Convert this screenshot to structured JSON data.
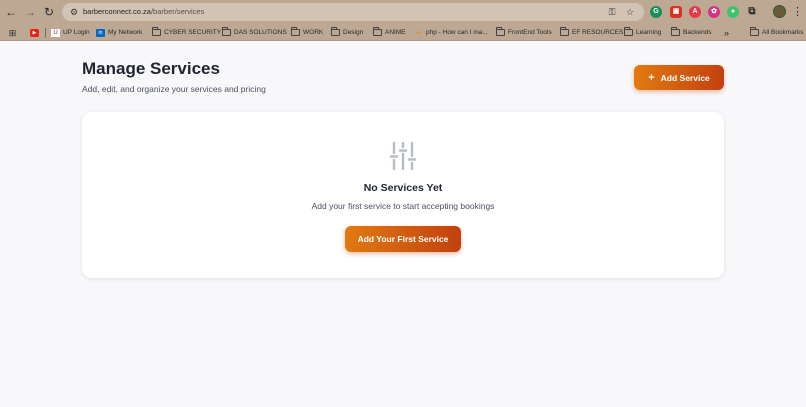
{
  "browser": {
    "url_host": "barberconnect.co.za",
    "url_path": "/barber/services",
    "bookmarks": [
      {
        "label": "",
        "icon": "youtube-icon"
      },
      {
        "label": "UP Login",
        "icon": "up-icon"
      },
      {
        "label": "My Network",
        "icon": "linkedin-icon"
      },
      {
        "label": "CYBER SECURITY",
        "icon": "folder-icon"
      },
      {
        "label": "DAS SOLUTIONS",
        "icon": "folder-icon"
      },
      {
        "label": "WORK",
        "icon": "folder-icon"
      },
      {
        "label": "Design",
        "icon": "folder-icon"
      },
      {
        "label": "ANIME",
        "icon": "folder-icon"
      },
      {
        "label": "php - How can I ma...",
        "icon": "stackoverflow-icon"
      },
      {
        "label": "FrontEnd Tools",
        "icon": "folder-icon"
      },
      {
        "label": "EF RESOURCES",
        "icon": "folder-icon"
      },
      {
        "label": "Learning",
        "icon": "folder-icon"
      },
      {
        "label": "Backends",
        "icon": "folder-icon"
      }
    ],
    "all_bookmarks_label": "All Bookmarks",
    "overflow_label": "»"
  },
  "header": {
    "title": "Manage Services",
    "subtitle": "Add, edit, and organize your services and pricing",
    "add_button_label": "Add Service",
    "add_button_icon": "+"
  },
  "empty_state": {
    "icon": "sliders-icon",
    "title": "No Services Yet",
    "message": "Add your first service to start accepting bookings",
    "button_label": "Add Your First Service"
  },
  "colors": {
    "accent_start": "#e17a10",
    "accent_end": "#c2410f",
    "chrome": "#bda894",
    "page_bg": "#f8f8fa"
  }
}
